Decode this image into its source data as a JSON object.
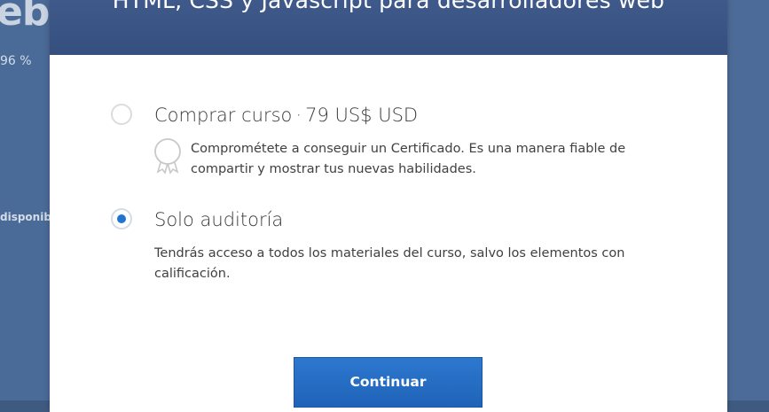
{
  "background": {
    "heading_fragment": "eb",
    "percent_fragment": "96 %",
    "availability_fragment": "disponibl"
  },
  "modal": {
    "title": "HTML, CSS y Javascript para desarrolladores web",
    "options": [
      {
        "title": "Comprar curso",
        "separator": "·",
        "price": "79 US$ USD",
        "description": "Comprométete a conseguir un Certificado. Es una manera fiable de compartir y mostrar tus nuevas habilidades.",
        "selected": false,
        "icon": "certificate-ribbon-icon"
      },
      {
        "title": "Solo auditoría",
        "description": "Tendrás acceso a todos los materiales del curso, salvo los elementos con calificación.",
        "selected": true
      }
    ],
    "continue_label": "Continuar"
  },
  "colors": {
    "header": "#3a5585",
    "accent": "#1f74d0",
    "backdrop": "#4a6a97"
  }
}
